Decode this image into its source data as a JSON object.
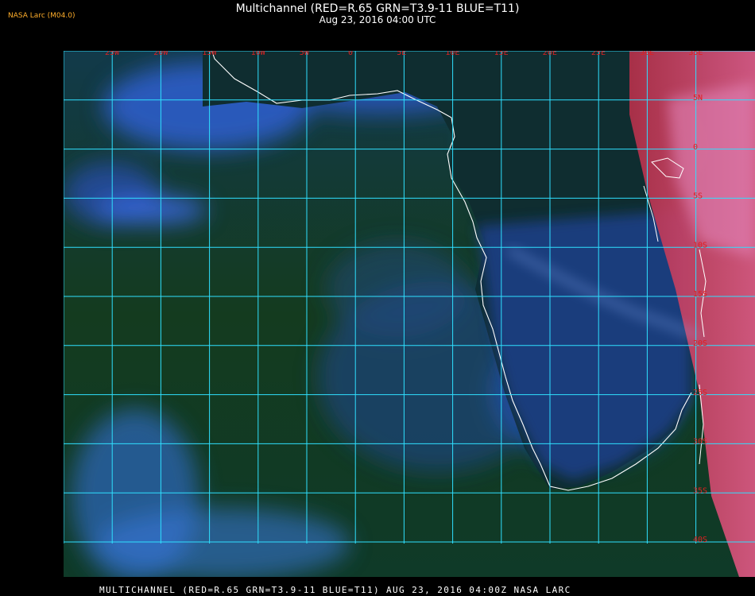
{
  "header": {
    "title": "Multichannel (RED=R.65 GRN=T3.9-11 BLUE=T11)",
    "subtitle": "Aug 23, 2016 04:00 UTC"
  },
  "credit": "NASA Larc (M04.0)",
  "footer": {
    "caption": "MULTICHANNEL (RED=R.65 GRN=T3.9-11 BLUE=T11) AUG 23, 2016 04:00Z NASA LARC"
  },
  "map": {
    "longitude_labels": [
      "25W",
      "20W",
      "15W",
      "10W",
      "5W",
      "0",
      "5E",
      "10E",
      "15E",
      "20E",
      "25E",
      "30E",
      "35E"
    ],
    "latitude_labels": [
      "5N",
      "0",
      "5S",
      "10S",
      "15S",
      "20S",
      "25S",
      "30S",
      "35S",
      "40S"
    ],
    "colors": {
      "grid": "#2fe0ff",
      "label": "#e02020",
      "coastline": "#ffffff",
      "ocean": "#14391a",
      "cloud_blue": "#3a6bd8",
      "land_red": "#c83a52"
    }
  }
}
